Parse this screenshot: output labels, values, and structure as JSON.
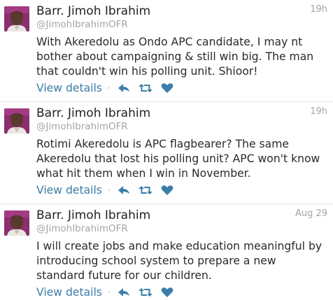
{
  "accent_color": "#3b7ea8",
  "action_labels": {
    "view_details": "View details",
    "separator": "·",
    "icons": [
      "reply-icon",
      "retweet-icon",
      "favorite-icon"
    ]
  },
  "tweets": [
    {
      "name": "Barr. Jimoh Ibrahim",
      "handle": "@JimohIbrahimOFR",
      "time": "19h",
      "lines": [
        "With Akeredolu as Ondo APC candidate, I may nt",
        "bother about campaigning & still win big. The man",
        "that couldn't win his polling unit. Shioor!"
      ]
    },
    {
      "name": "Barr. Jimoh Ibrahim",
      "handle": "@JimohIbrahimOFR",
      "time": "19h",
      "lines": [
        "Rotimi Akeredolu is APC flagbearer? The same",
        "Akeredolu that lost his polling unit? APC won't know",
        "what hit them when I win in November."
      ]
    },
    {
      "name": "Barr. Jimoh Ibrahim",
      "handle": "@JimohIbrahimOFR",
      "time": "Aug 29",
      "lines": [
        "I will create jobs and make education meaningful by",
        "introducing school system to prepare a new",
        "standard future for our children."
      ]
    }
  ]
}
